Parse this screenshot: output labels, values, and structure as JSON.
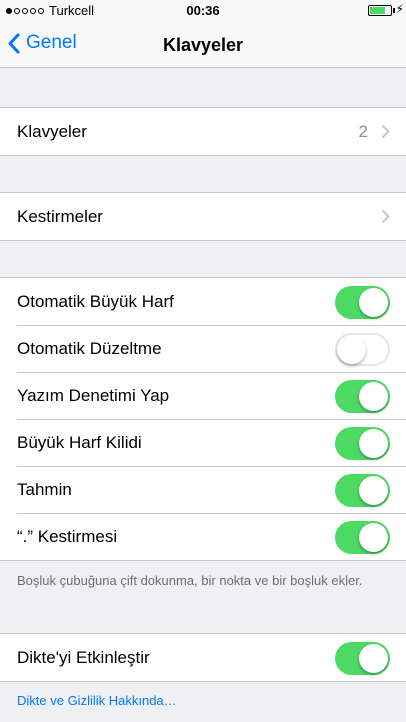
{
  "status_bar": {
    "carrier": "Turkcell",
    "time": "00:36",
    "signal_bars": 1,
    "battery_level": 0.6
  },
  "nav": {
    "back_label": "Genel",
    "title": "Klavyeler"
  },
  "group1": {
    "label": "Klavyeler",
    "value": "2"
  },
  "group2": {
    "label": "Kestirmeler"
  },
  "toggles": [
    {
      "label": "Otomatik Büyük Harf",
      "on": true
    },
    {
      "label": "Otomatik Düzeltme",
      "on": false
    },
    {
      "label": "Yazım Denetimi Yap",
      "on": true
    },
    {
      "label": "Büyük Harf Kilidi",
      "on": true
    },
    {
      "label": "Tahmin",
      "on": true
    },
    {
      "label": "“.” Kestirmesi",
      "on": true
    }
  ],
  "toggles_footer": "Boşluk çubuğuna çift dokunma, bir nokta ve bir boşluk ekler.",
  "dictation": {
    "label": "Dikte'yi Etkinleştir",
    "on": true
  },
  "dictation_link": "Dikte ve Gizlilik Hakkında…",
  "colors": {
    "accent": "#007aff",
    "switch_on": "#4cd964",
    "background": "#efeff4"
  }
}
